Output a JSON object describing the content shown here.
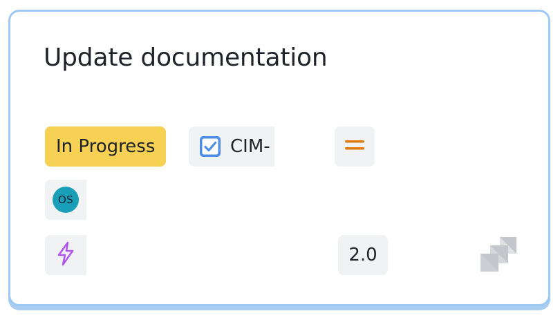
{
  "card": {
    "title": "Update documentation",
    "status": "In Progress",
    "issue_type_icon": "checkbox-icon",
    "issue_key": "CIM-",
    "priority_icon": "priority-medium-icon",
    "assignee_initials": "OS",
    "work_type_icon": "lightning-icon",
    "estimate": "2.0",
    "logo_icon": "jira-logo-icon"
  },
  "colors": {
    "card_border": "#9ec9f2",
    "status_badge": "#f6d154",
    "chip_background": "#f1f2f4",
    "checkbox": "#4c8ee8",
    "priority": "#e07b12",
    "avatar": "#1a9fb9",
    "lightning": "#b257ee",
    "logo": "#c3c6cb"
  }
}
